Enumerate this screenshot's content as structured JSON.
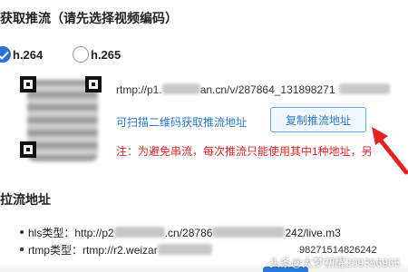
{
  "push_section": {
    "title": "获取推流（请先选择视频编码）",
    "codecs": [
      {
        "label": "h.264",
        "selected": true
      },
      {
        "label": "h.265",
        "selected": false
      }
    ],
    "rtmp_prefix": "rtmp://p1.",
    "rtmp_mid": "an.cn/v/287864_131898271",
    "scan_hint": "可扫描二维码获取推流地址",
    "copy_button_label": "复制推流地址",
    "notice": "注：为避免串流，每次推流只能使用其中1种地址，另"
  },
  "pull_section": {
    "title": "拉流地址",
    "hls_label": "hls类型：",
    "hls_prefix": "http://p2",
    "hls_mid": ".cn/28786",
    "hls_suffix": "242/live.m3",
    "rtmp_label": "rtmp类型：",
    "rtmp_value": "rtmp://r2.weizar",
    "trailing_number": "98271514826242"
  },
  "watermark": "头条@大梦初醒209356965",
  "colors": {
    "accent": "#2b7bd6",
    "notice_red": "#e52222",
    "radio_checked": "#2d6fd6"
  },
  "icons": {
    "annotation_arrow": "red-arrow-icon",
    "checked_radio": "check-icon"
  }
}
